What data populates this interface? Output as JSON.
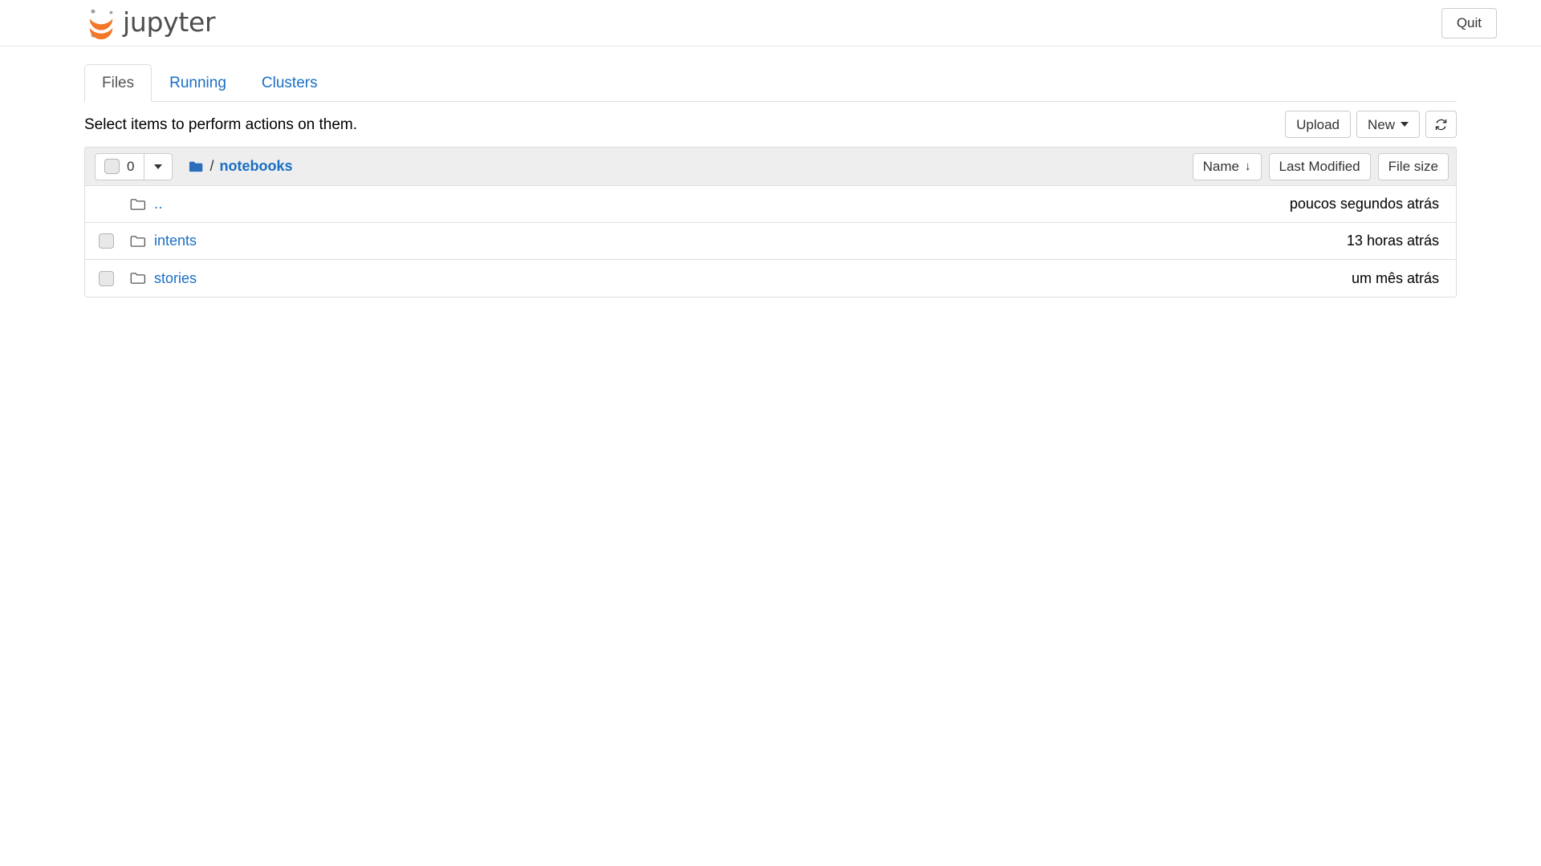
{
  "header": {
    "brand_text": "jupyter",
    "logo_icon": "jupyter-logo",
    "quit_label": "Quit",
    "colors": {
      "logo_orange": "#F37726",
      "logo_gray": "#9E9E9E",
      "brand_gray": "#4E4E4E",
      "link_blue": "#1A6FC4",
      "folder_blue": "#2A6EBB",
      "header_border": "#E7E7E7"
    }
  },
  "tabs": [
    {
      "label": "Files",
      "active": true
    },
    {
      "label": "Running",
      "active": false
    },
    {
      "label": "Clusters",
      "active": false
    }
  ],
  "toolbar": {
    "select_hint": "Select items to perform actions on them.",
    "upload_label": "Upload",
    "new_label": "New",
    "new_caret_icon": "chevron-down-icon",
    "refresh_icon": "refresh-icon",
    "refresh_glyph": "↻"
  },
  "list_header": {
    "select_all_checkbox_icon": "checkbox-unchecked-icon",
    "selected_count": "0",
    "dropdown_caret_icon": "chevron-down-icon",
    "breadcrumb": {
      "root_icon": "folder-solid-icon",
      "separator": "/",
      "current": "notebooks"
    },
    "sort_buttons": [
      {
        "label": "Name",
        "arrow": "↓",
        "active": true,
        "name": "sort-name"
      },
      {
        "label": "Last Modified",
        "arrow": "",
        "active": false,
        "name": "sort-last-modified"
      },
      {
        "label": "File size",
        "arrow": "",
        "active": false,
        "name": "sort-file-size"
      }
    ]
  },
  "rows": [
    {
      "name": "..",
      "icon": "folder-outline-icon",
      "has_checkbox": false,
      "is_parent": true,
      "modified": "poucos segundos atrás",
      "size": ""
    },
    {
      "name": "intents",
      "icon": "folder-outline-icon",
      "has_checkbox": true,
      "is_parent": false,
      "modified": "13 horas atrás",
      "size": ""
    },
    {
      "name": "stories",
      "icon": "folder-outline-icon",
      "has_checkbox": true,
      "is_parent": false,
      "modified": "um mês atrás",
      "size": ""
    }
  ]
}
